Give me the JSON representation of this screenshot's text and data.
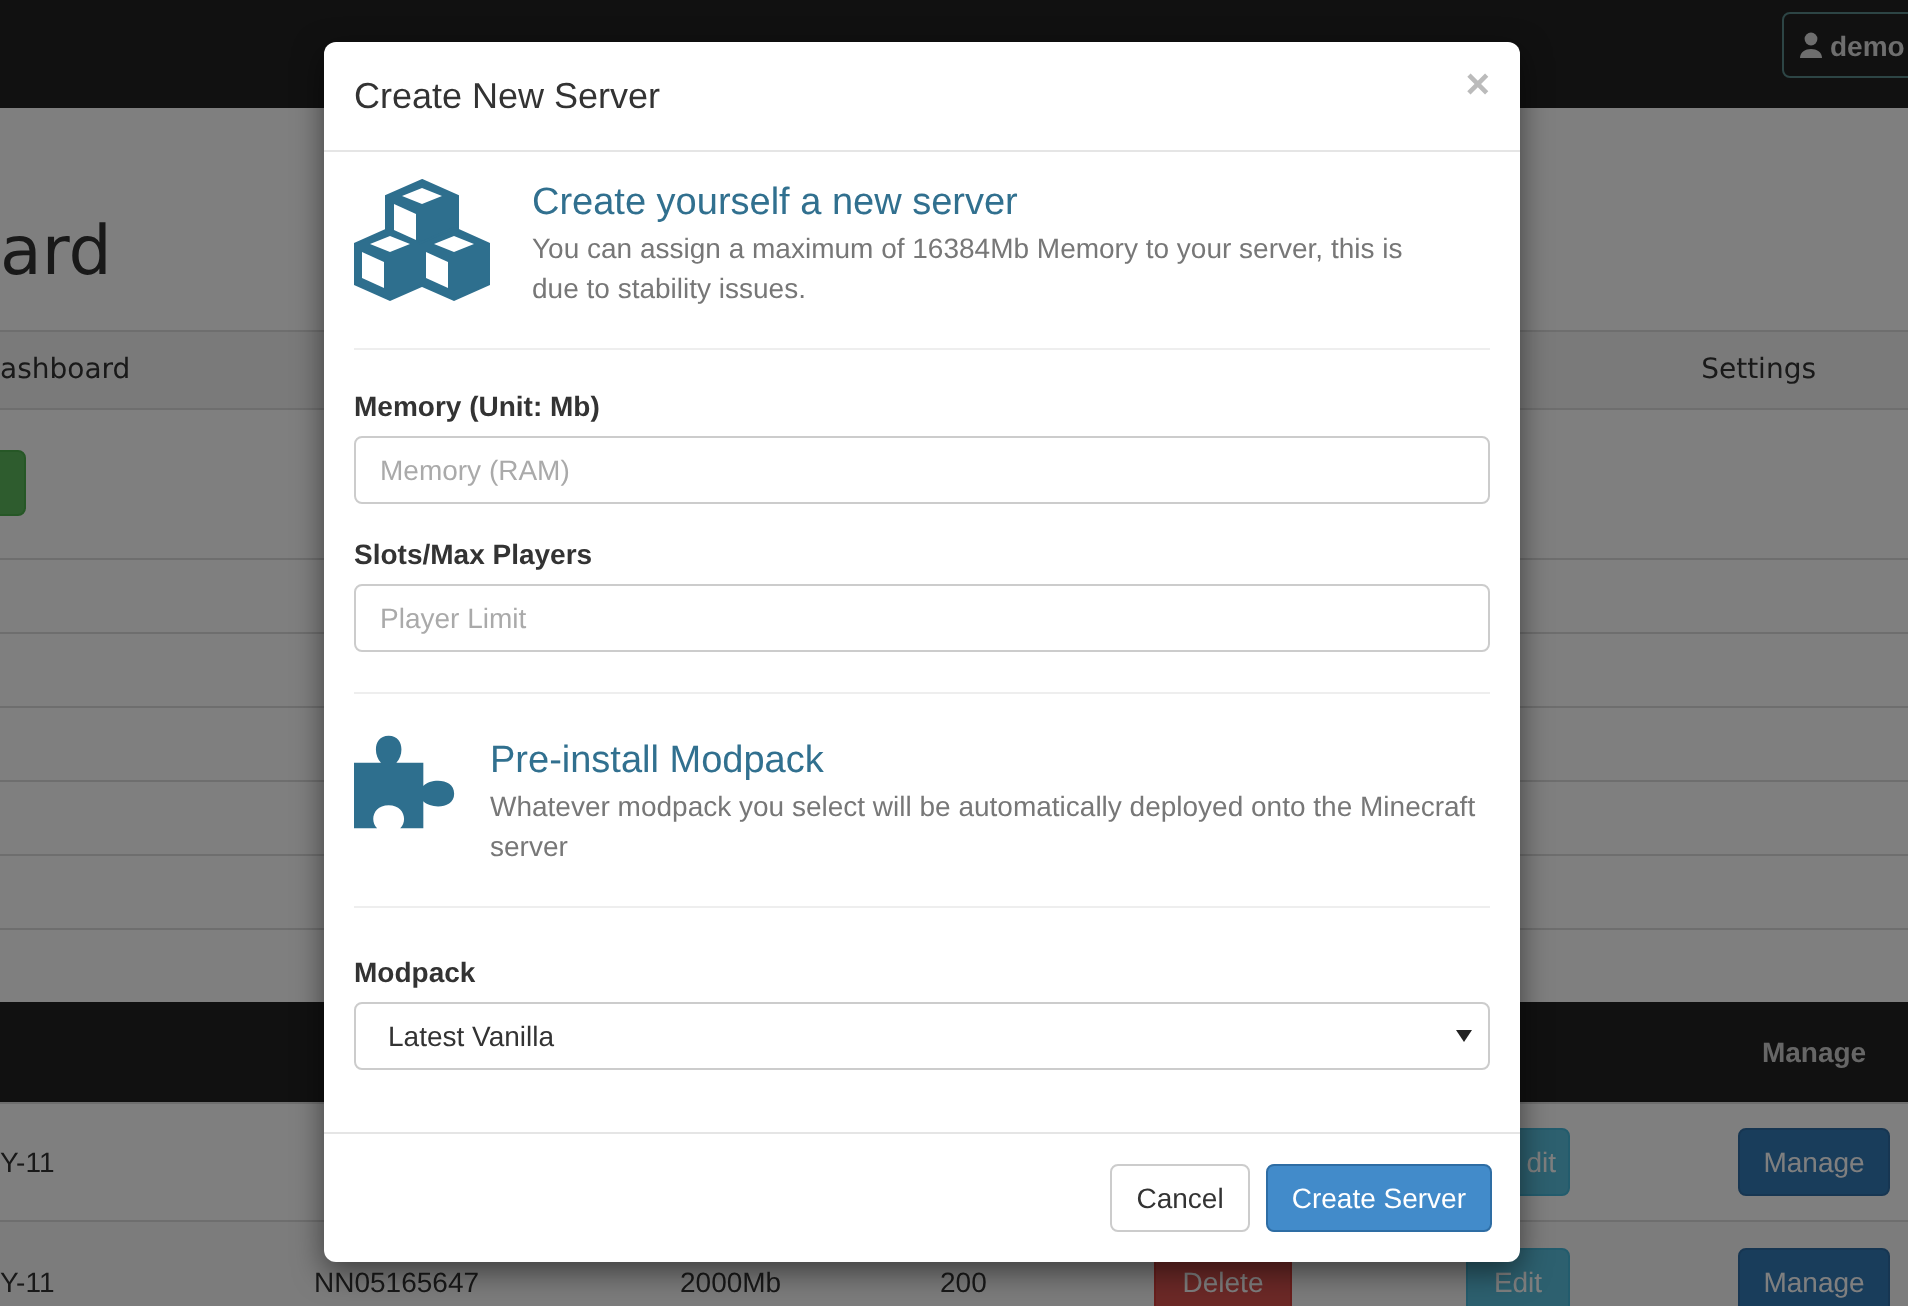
{
  "navbar": {
    "user_button": "demo"
  },
  "page": {
    "heading": "ard",
    "nav_items": [
      {
        "label": "ashboard"
      },
      {
        "label": "Settings"
      }
    ]
  },
  "table": {
    "header": {
      "column_7": "Manage"
    },
    "rows": [
      {
        "column_1": "Y-11",
        "edit": "dit",
        "manage": "Manage"
      },
      {
        "column_1": "Y-11",
        "column_2": "NN05165647",
        "column_3": "2000Mb",
        "column_4": "200",
        "delete": "Delete",
        "edit": "Edit",
        "manage": "Manage"
      }
    ]
  },
  "modal": {
    "title": "Create New Server",
    "close": "×",
    "sections": [
      {
        "kind": "cubes",
        "heading": "Create yourself a new server",
        "text": "You can assign a maximum of 16384Mb Memory to your server, this is due to stability issues.",
        "fields": [
          {
            "label": "Memory (Unit: Mb)",
            "placeholder": "Memory (RAM)"
          },
          {
            "label": "Slots/Max Players",
            "placeholder": "Player Limit"
          }
        ]
      },
      {
        "kind": "puzzle",
        "heading": "Pre-install Modpack",
        "text": "Whatever modpack you select will be automatically deployed onto the Minecraft server"
      }
    ],
    "select": {
      "label": "Modpack",
      "value": "Latest Vanilla"
    },
    "buttons": [
      {
        "label": "Cancel",
        "kind": "default"
      },
      {
        "label": "Create Server",
        "kind": "primary"
      }
    ]
  }
}
